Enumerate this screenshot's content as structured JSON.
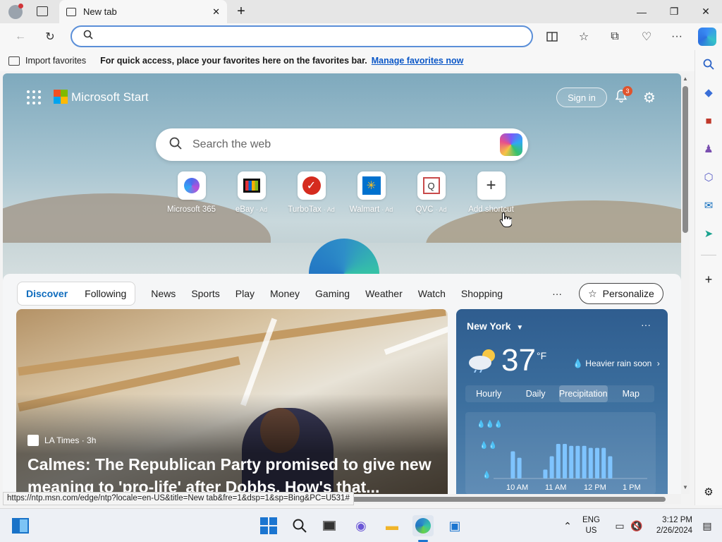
{
  "window": {
    "tab_title": "New tab",
    "minimize_glyph": "—",
    "maximize_glyph": "❐",
    "close_glyph": "✕"
  },
  "toolbar": {
    "address_value": "",
    "address_placeholder": ""
  },
  "favorites_bar": {
    "import_label": "Import favorites",
    "message": "For quick access, place your favorites here on the favorites bar.",
    "manage_link": "Manage favorites now"
  },
  "start_page": {
    "brand": "Microsoft Start",
    "sign_in": "Sign in",
    "notification_count": "3",
    "search_placeholder": "Search the web",
    "shortcuts": [
      {
        "label": "Microsoft 365",
        "ad": ""
      },
      {
        "label": "eBay",
        "ad": "· Ad"
      },
      {
        "label": "TurboTax",
        "ad": "· Ad"
      },
      {
        "label": "Walmart",
        "ad": "· Ad"
      },
      {
        "label": "QVC",
        "ad": "· Ad"
      },
      {
        "label": "Add shortcut",
        "ad": ""
      }
    ]
  },
  "feed_nav": {
    "toggle": [
      "Discover",
      "Following"
    ],
    "items": [
      "News",
      "Sports",
      "Play",
      "Money",
      "Gaming",
      "Weather",
      "Watch",
      "Shopping"
    ],
    "more": "···",
    "personalize": "Personalize"
  },
  "hero_card": {
    "source": "LA Times · 3h",
    "headline": "Calmes: The Republican Party promised to give new meaning to 'pro-life' after Dobbs. How's that..."
  },
  "weather": {
    "location": "New York",
    "temperature": "37",
    "unit": "°F",
    "alert": "Heavier rain soon",
    "tabs": [
      "Hourly",
      "Daily",
      "Precipitation",
      "Map"
    ],
    "time_labels": [
      "10 AM",
      "11 AM",
      "12 PM",
      "1 PM"
    ],
    "precip_levels": [
      0,
      0,
      0.55,
      0.42,
      0,
      0,
      0,
      0.18,
      0.45,
      0.7,
      0.7,
      0.66,
      0.66,
      0.66,
      0.62,
      0.62,
      0.62,
      0.45,
      0,
      0,
      0,
      0
    ]
  },
  "status_url": "https://ntp.msn.com/edge/ntp?locale=en-US&title=New tab&fre=1&dsp=1&sp=Bing&PC=U531#",
  "taskbar": {
    "lang_top": "ENG",
    "lang_bottom": "US",
    "time": "3:12 PM",
    "date": "2/26/2024"
  },
  "colors": {
    "accent": "#0f6cbd",
    "address_border": "#5b8fd8",
    "badge": "#e0532c"
  }
}
